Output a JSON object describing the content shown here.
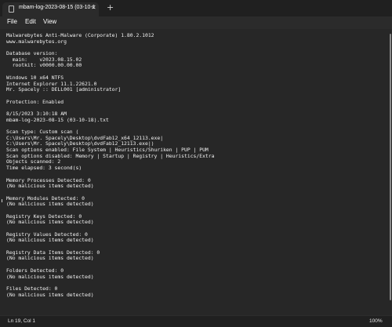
{
  "tab": {
    "title": "mbam-log-2023-08-15 (03-10-1",
    "close_glyph": "✕",
    "new_tab_glyph": "+",
    "icon": "document-icon"
  },
  "menu": {
    "items": [
      "File",
      "Edit",
      "View"
    ]
  },
  "editor": {
    "lines": [
      "Malwarebytes Anti-Malware (Corporate) 1.80.2.1012",
      "www.malwarebytes.org",
      "",
      "Database version:",
      "  main:    v2023.08.15.02",
      "  rootkit: v0000.00.00.00",
      "",
      "Windows 10 x64 NTFS",
      "Internet Explorer 11.1.22621.0",
      "Mr. Spacely :: DELL001 [administrator]",
      "",
      "Protection: Enabled",
      "",
      "8/15/2023 3:10:18 AM",
      "mbam-log-2023-08-15 (03-10-18).txt",
      "",
      "Scan type: Custom scan (",
      "C:\\Users\\Mr. Spacely\\Desktop\\dvdFab12_x64_12113.exe|",
      "C:\\Users\\Mr. Spacely\\Desktop\\dvdFab12_12113.exe|)",
      "Scan options enabled: File System | Heuristics/Shuriken | PUP | PUM",
      "Scan options disabled: Memory | Startup | Registry | Heuristics/Extra",
      "Objects scanned: 2",
      "Time elapsed: 3 second(s)",
      "",
      "Memory Processes Detected: 0",
      "(No malicious items detected)",
      "",
      "Memory Modules Detected: 0",
      "(No malicious items detected)",
      "",
      "Registry Keys Detected: 0",
      "(No malicious items detected)",
      "",
      "Registry Values Detected: 0",
      "(No malicious items detected)",
      "",
      "Registry Data Items Detected: 0",
      "(No malicious items detected)",
      "",
      "Folders Detected: 0",
      "(No malicious items detected)",
      "",
      "Files Detected: 0",
      "(No malicious items detected)"
    ]
  },
  "status": {
    "position": "Ln 19, Col 1",
    "zoom": "100%"
  }
}
